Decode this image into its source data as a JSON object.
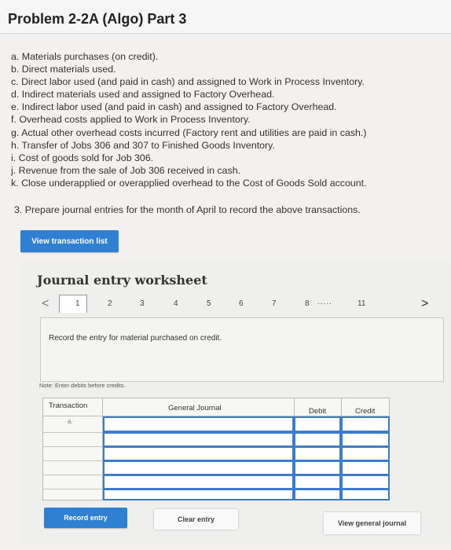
{
  "header": {
    "title": "Problem 2-2A (Algo) Part 3"
  },
  "problem": {
    "items": [
      "a. Materials purchases (on credit).",
      "b. Direct materials used.",
      "c. Direct labor used (and paid in cash) and assigned to Work in Process Inventory.",
      "d. Indirect materials used and assigned to Factory Overhead.",
      "e. Indirect labor used (and paid in cash) and assigned to Factory Overhead.",
      "f. Overhead costs applied to Work in Process Inventory.",
      "g. Actual other overhead costs incurred (Factory rent and utilities are paid in cash.)",
      "h. Transfer of Jobs 306 and 307 to Finished Goods Inventory.",
      "i. Cost of goods sold for Job 306.",
      "j. Revenue from the sale of Job 306 received in cash.",
      "k. Close underapplied or overapplied overhead to the Cost of Goods Sold account."
    ],
    "prompt": "3. Prepare journal entries for the month of April to record the above transactions."
  },
  "buttons": {
    "view_transaction_list": "View transaction list",
    "record_entry": "Record entry",
    "clear_entry": "Clear entry",
    "view_general_journal": "View general journal"
  },
  "worksheet": {
    "title": "Journal entry worksheet",
    "tabs": [
      "1",
      "2",
      "3",
      "4",
      "5",
      "6",
      "7",
      "8"
    ],
    "ellipsis": ".....",
    "last_tab": "11",
    "prev_arrow": "<",
    "next_arrow": ">",
    "instruction": "Record the entry for material purchased on credit.",
    "note": "Note: Enter debits before credits.",
    "columns": {
      "transaction": "Transaction",
      "general_journal": "General Journal",
      "debit": "Debit",
      "credit": "Credit"
    },
    "first_transaction": "a."
  },
  "colors": {
    "accent": "#2f7fd3",
    "cell_border": "#3c7cc8"
  }
}
